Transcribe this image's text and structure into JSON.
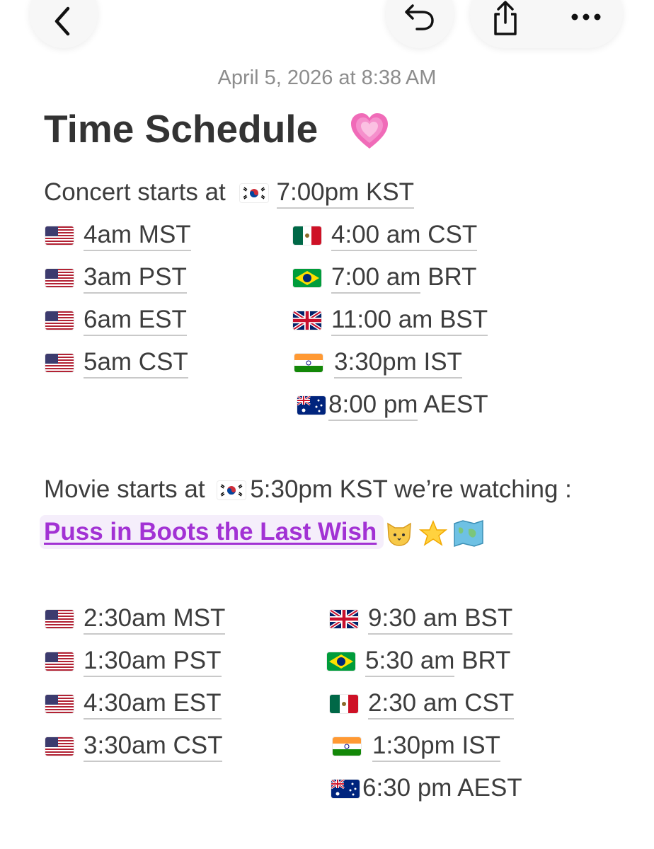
{
  "topbar": {
    "back": "chevron-left-icon",
    "undo": "undo-icon",
    "share": "share-icon",
    "more": "more-icon"
  },
  "note": {
    "date": "April 5, 2026 at 8:38 AM",
    "title": "Time Schedule"
  },
  "concert": {
    "intro": "Concert starts at",
    "kst": "7:00pm KST",
    "left": [
      {
        "flag": "us",
        "time": "4am MST"
      },
      {
        "flag": "us",
        "time": "3am PST"
      },
      {
        "flag": "us",
        "time": "6am EST"
      },
      {
        "flag": "us",
        "time": "5am CST"
      }
    ],
    "right": [
      {
        "flag": "mx",
        "time": "4:00 am",
        "zone": " CST"
      },
      {
        "flag": "br",
        "time": "7:00 am",
        "zone": " BRT"
      },
      {
        "flag": "gb",
        "time": "11:00 am",
        "zone": " BST"
      },
      {
        "flag": "in",
        "time": "3:30pm",
        "zone": " IST"
      },
      {
        "flag": "au",
        "time": "8:00 pm",
        "zone": " AEST"
      }
    ]
  },
  "movie": {
    "intro": "Movie starts at",
    "kst": "5:30pm KST we’re watching :",
    "link": "Puss in Boots the Last Wish ",
    "left": [
      {
        "flag": "us",
        "time": "2:30am MST"
      },
      {
        "flag": "us",
        "time": "1:30am PST"
      },
      {
        "flag": "us",
        "time": "4:30am EST"
      },
      {
        "flag": "us",
        "time": "3:30am CST"
      }
    ],
    "right": [
      {
        "flag": "gb",
        "time": "9:30 am",
        "zone": " BST"
      },
      {
        "flag": "br",
        "time": "5:30 am",
        "zone": " BRT"
      },
      {
        "flag": "mx",
        "time": "2:30 am",
        "zone": " CST"
      },
      {
        "flag": "in",
        "time": "1:30pm",
        "zone": " IST"
      },
      {
        "flag": "au",
        "time": "6:30 pm",
        "zone": " AEST"
      }
    ]
  }
}
